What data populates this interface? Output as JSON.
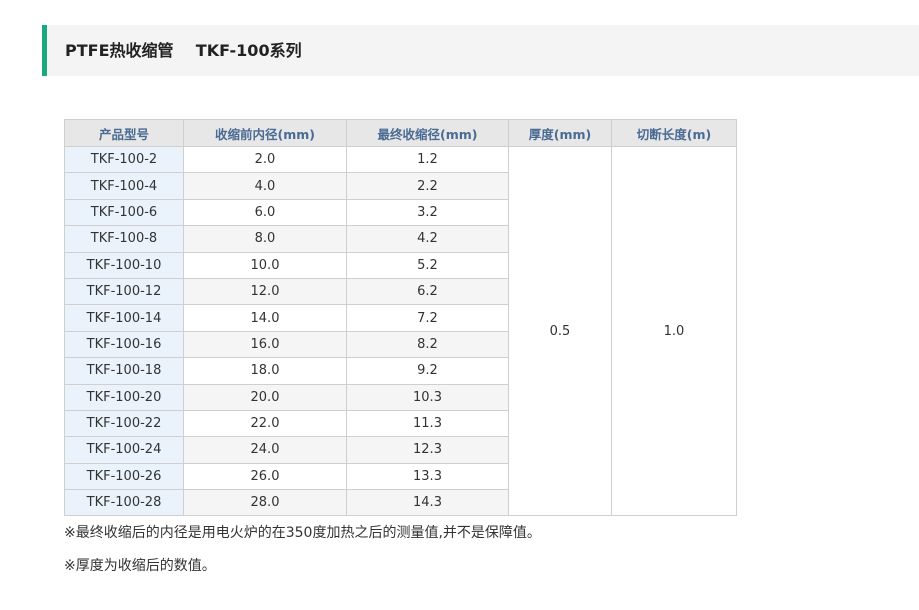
{
  "title": "PTFE热收缩管    TKF-100系列",
  "table": {
    "headers": [
      "产品型号",
      "收缩前内径(mm)",
      "最终收缩径(mm)",
      "厚度(mm)",
      "切断长度(m)"
    ],
    "rows": [
      [
        "TKF-100-2",
        "2.0",
        "1.2"
      ],
      [
        "TKF-100-4",
        "4.0",
        "2.2"
      ],
      [
        "TKF-100-6",
        "6.0",
        "3.2"
      ],
      [
        "TKF-100-8",
        "8.0",
        "4.2"
      ],
      [
        "TKF-100-10",
        "10.0",
        "5.2"
      ],
      [
        "TKF-100-12",
        "12.0",
        "6.2"
      ],
      [
        "TKF-100-14",
        "14.0",
        "7.2"
      ],
      [
        "TKF-100-16",
        "16.0",
        "8.2"
      ],
      [
        "TKF-100-18",
        "18.0",
        "9.2"
      ],
      [
        "TKF-100-20",
        "20.0",
        "10.3"
      ],
      [
        "TKF-100-22",
        "22.0",
        "11.3"
      ],
      [
        "TKF-100-24",
        "24.0",
        "12.3"
      ],
      [
        "TKF-100-26",
        "26.0",
        "13.3"
      ],
      [
        "TKF-100-28",
        "28.0",
        "14.3"
      ]
    ],
    "thickness": "0.5",
    "cut_length": "1.0"
  },
  "notes": [
    "※最终收缩后的内径是用电火炉的在350度加热之后的测量值,并不是保障值。",
    "※厚度为收缩后的数值。"
  ],
  "colors": {
    "accent": "#1aa881",
    "header_text": "#4a6b93",
    "header_bg": "#e7e7e7",
    "model_cell_bg": "#eaf3fb"
  }
}
